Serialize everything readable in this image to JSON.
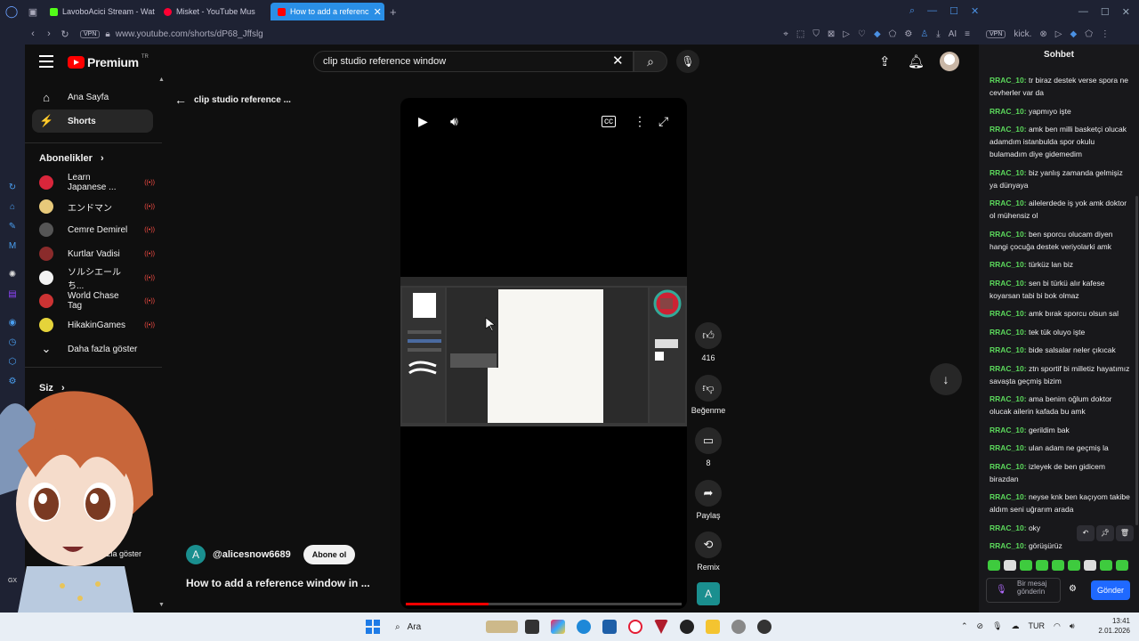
{
  "browser": {
    "tabs": [
      {
        "label": "LavoboAcici Stream - Wat",
        "color": "#53fc18"
      },
      {
        "label": "Misket - YouTube Mus",
        "color": "#ff0033"
      },
      {
        "label": "How to add a referenc",
        "color": "#ff0000",
        "active": true
      }
    ],
    "url": "www.youtube.com/shorts/dP68_Jffslg",
    "vpn_label": "VPN",
    "second_url": "kick.",
    "ai_label": "AI"
  },
  "youtube": {
    "logo_text": "Premium",
    "logo_region": "TR",
    "search_value": "clip studio reference window",
    "nav": {
      "home": "Ana Sayfa",
      "shorts": "Shorts",
      "subscriptions_title": "Abonelikler",
      "subscriptions": [
        {
          "name": "Learn Japanese ...",
          "color": "#d9263b"
        },
        {
          "name": "エンドマン",
          "color": "#e7c97a"
        },
        {
          "name": "Cemre Demirel",
          "color": "#555555"
        },
        {
          "name": "Kurtlar Vadisi",
          "color": "#8a2b2b"
        },
        {
          "name": "ソルシエールち...",
          "color": "#f2f2f2"
        },
        {
          "name": "World Chase Tag",
          "color": "#cc3333"
        },
        {
          "name": "HikakinGames",
          "color": "#e5d33a"
        }
      ],
      "show_more": "Daha fazla göster",
      "you_title": "Siz",
      "you_fragment_1": "iş",
      "you_fragment_2": "teleri",
      "you_fragment_3": "lar",
      "you_fragment_4": "zla göster"
    },
    "short": {
      "back_title": "clip studio reference ...",
      "channel": "@alicesnow6689",
      "channel_initial": "A",
      "subscribe": "Abone ol",
      "title": "How to add a reference window in ...",
      "progress": 0.3,
      "likes": "416",
      "dislike_label": "Beğenme",
      "comments": "8",
      "share_label": "Paylaş",
      "remix_label": "Remix",
      "remix_initial": "A"
    }
  },
  "chat": {
    "title": "Sohbet",
    "messages": [
      {
        "user": "RRAC_10:",
        "text": "tr biraz destek verse spora ne cevherler var da"
      },
      {
        "user": "RRAC_10:",
        "text": "yapmıyo işte"
      },
      {
        "user": "RRAC_10:",
        "text": "amk ben milli basketçi olucak adamdım istanbulda spor okulu bulamadım diye gidemedim"
      },
      {
        "user": "RRAC_10:",
        "text": "biz yanlış zamanda gelmişiz ya dünyaya"
      },
      {
        "user": "RRAC_10:",
        "text": "ailelerdede iş yok amk doktor ol mühensiz ol"
      },
      {
        "user": "RRAC_10:",
        "text": "ben sporcu olucam diyen hangi çocuğa destek veriyolarki amk"
      },
      {
        "user": "RRAC_10:",
        "text": "türküz lan biz"
      },
      {
        "user": "RRAC_10:",
        "text": "sen bi türkü alır kafese koyarsan tabi bi bok olmaz"
      },
      {
        "user": "RRAC_10:",
        "text": "amk bırak sporcu olsun sal"
      },
      {
        "user": "RRAC_10:",
        "text": "tek tük oluyo işte"
      },
      {
        "user": "RRAC_10:",
        "text": "bide salsalar neler çıkıcak"
      },
      {
        "user": "RRAC_10:",
        "text": "ztn sportif bi milletiz hayatımız savaşta geçmiş bizim"
      },
      {
        "user": "RRAC_10:",
        "text": "ama benim oğlum doktor olucak ailerin kafada bu amk"
      },
      {
        "user": "RRAC_10:",
        "text": "gerildim bak"
      },
      {
        "user": "RRAC_10:",
        "text": "ulan adam ne geçmiş la"
      },
      {
        "user": "RRAC_10:",
        "text": "izleyek de ben gidicem birazdan"
      },
      {
        "user": "RRAC_10:",
        "text": "neyse knk ben kaçıyom takibe aldım seni uğrarım arada"
      },
      {
        "user": "RRAC_10:",
        "text": "oky"
      },
      {
        "user": "RRAC_10:",
        "text": "görüşürüz"
      }
    ],
    "input_placeholder": "Bir mesaj gönderin",
    "send": "Gönder"
  },
  "taskbar": {
    "search": "Ara",
    "lang": "TUR",
    "time": "13:41",
    "date": "2.01.2026"
  },
  "colors": {
    "youtube_red": "#ff0000",
    "chat_user": "#5bd75b",
    "kick_send": "#1f69ff"
  }
}
